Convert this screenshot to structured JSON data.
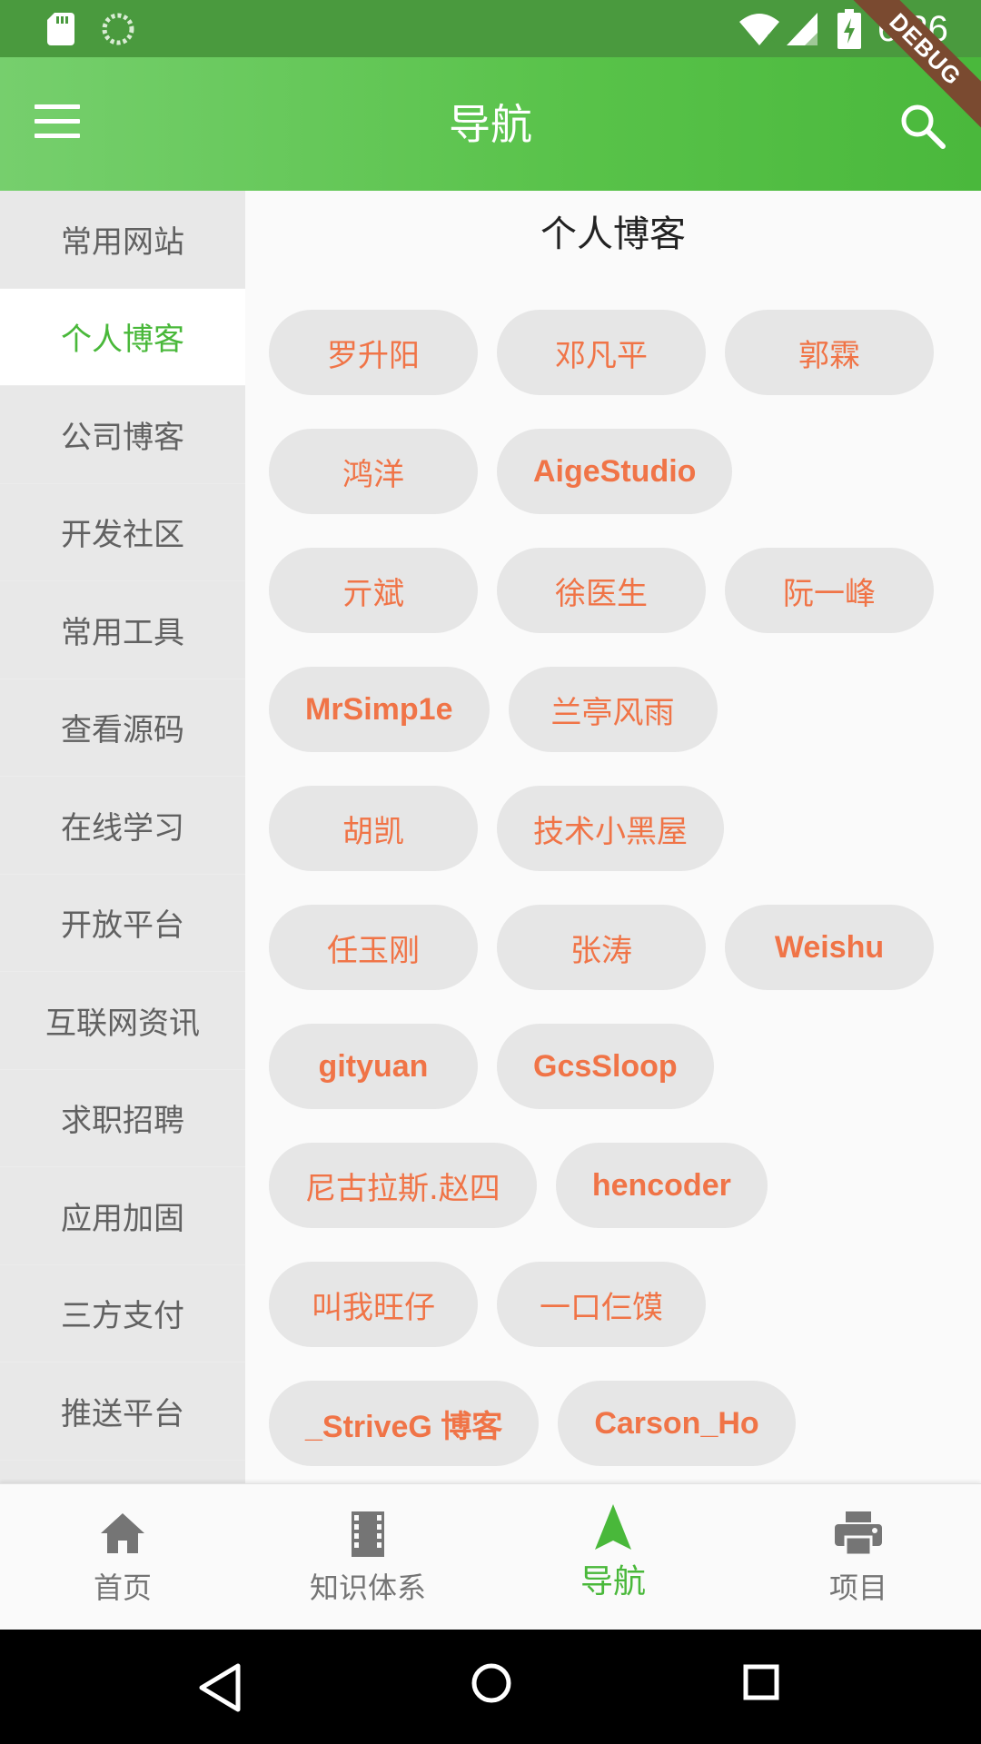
{
  "status_bar": {
    "time": "6:26"
  },
  "debug_banner": "DEBUG",
  "app_bar": {
    "title": "导航"
  },
  "sidebar": {
    "items": [
      {
        "label": "常用网站",
        "active": false
      },
      {
        "label": "个人博客",
        "active": true
      },
      {
        "label": "公司博客",
        "active": false
      },
      {
        "label": "开发社区",
        "active": false
      },
      {
        "label": "常用工具",
        "active": false
      },
      {
        "label": "查看源码",
        "active": false
      },
      {
        "label": "在线学习",
        "active": false
      },
      {
        "label": "开放平台",
        "active": false
      },
      {
        "label": "互联网资讯",
        "active": false
      },
      {
        "label": "求职招聘",
        "active": false
      },
      {
        "label": "应用加固",
        "active": false
      },
      {
        "label": "三方支付",
        "active": false
      },
      {
        "label": "推送平台",
        "active": false
      }
    ]
  },
  "content": {
    "section_title": "个人博客",
    "rows": [
      [
        "罗升阳",
        "邓凡平",
        "郭霖"
      ],
      [
        "鸿洋",
        "AigeStudio"
      ],
      [
        "亓斌",
        "徐医生",
        "阮一峰"
      ],
      [
        "MrSimp1e",
        "兰亭风雨"
      ],
      [
        "胡凯",
        "技术小黑屋"
      ],
      [
        "任玉刚",
        "张涛",
        "Weishu"
      ],
      [
        "gityuan",
        "GcsSloop"
      ],
      [
        "尼古拉斯.赵四",
        "hencoder"
      ],
      [
        "叫我旺仔",
        "一口仨馍"
      ],
      [
        "_StriveG 博客",
        "Carson_Ho"
      ]
    ]
  },
  "bottom_nav": {
    "items": [
      {
        "label": "首页",
        "icon": "home-icon",
        "active": false
      },
      {
        "label": "知识体系",
        "icon": "film-icon",
        "active": false
      },
      {
        "label": "导航",
        "icon": "navigation-arrow-icon",
        "active": true
      },
      {
        "label": "项目",
        "icon": "printer-icon",
        "active": false
      }
    ]
  },
  "colors": {
    "accent": "#49b83a",
    "chip_text": "#f07447",
    "chip_bg": "#e6e6e6",
    "sidebar_bg": "#e8e8e8"
  }
}
